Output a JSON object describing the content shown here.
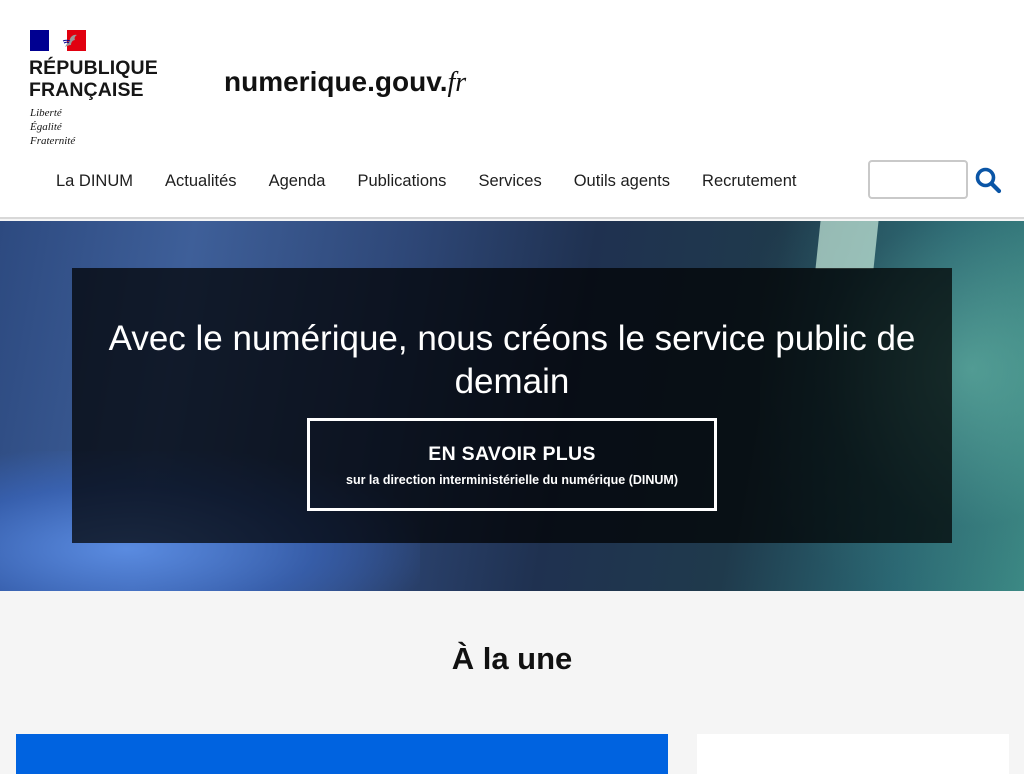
{
  "header": {
    "republic_line1": "République",
    "republic_line2": "Française",
    "motto": [
      "Liberté",
      "Égalité",
      "Fraternité"
    ],
    "site_title_main": "numerique.gouv.",
    "site_title_tld": "fr"
  },
  "nav": {
    "items": [
      {
        "label": "La DINUM"
      },
      {
        "label": "Actualités"
      },
      {
        "label": "Agenda"
      },
      {
        "label": "Publications"
      },
      {
        "label": "Services"
      },
      {
        "label": "Outils agents"
      },
      {
        "label": "Recrutement"
      }
    ]
  },
  "search": {
    "value": "",
    "icon": "search-icon"
  },
  "hero": {
    "headline": "Avec le numérique, nous créons le service public de demain",
    "cta_main": "EN SAVOIR PLUS",
    "cta_sub": "sur la direction interministérielle du numérique (DINUM)"
  },
  "section": {
    "title": "À la une"
  },
  "colors": {
    "flag_blue": "#000091",
    "flag_red": "#e1000f",
    "accent_blue": "#0063e0",
    "search_icon": "#0a55a6"
  }
}
